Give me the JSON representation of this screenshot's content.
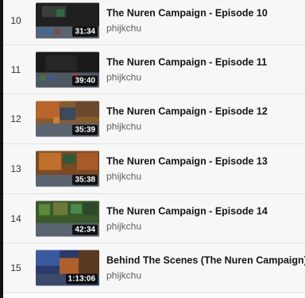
{
  "playlist": {
    "items": [
      {
        "index": "10",
        "title": "The Nuren Campaign - Episode 10",
        "channel": "phijkchu",
        "duration": "31:34",
        "thumb_scene": "dark"
      },
      {
        "index": "11",
        "title": "The Nuren Campaign - Episode 11",
        "channel": "phijkchu",
        "duration": "39:40",
        "thumb_scene": "dark"
      },
      {
        "index": "12",
        "title": "The Nuren Campaign - Episode 12",
        "channel": "phijkchu",
        "duration": "35:39",
        "thumb_scene": "lava"
      },
      {
        "index": "13",
        "title": "The Nuren Campaign - Episode 13",
        "channel": "phijkchu",
        "duration": "35:38",
        "thumb_scene": "lava"
      },
      {
        "index": "14",
        "title": "The Nuren Campaign - Episode 14",
        "channel": "phijkchu",
        "duration": "42:34",
        "thumb_scene": "grass"
      },
      {
        "index": "15",
        "title": "Behind The Scenes (The Nuren Campaign)",
        "channel": "phijkchu",
        "duration": "1:13:06",
        "thumb_scene": "blue-lava"
      }
    ]
  }
}
